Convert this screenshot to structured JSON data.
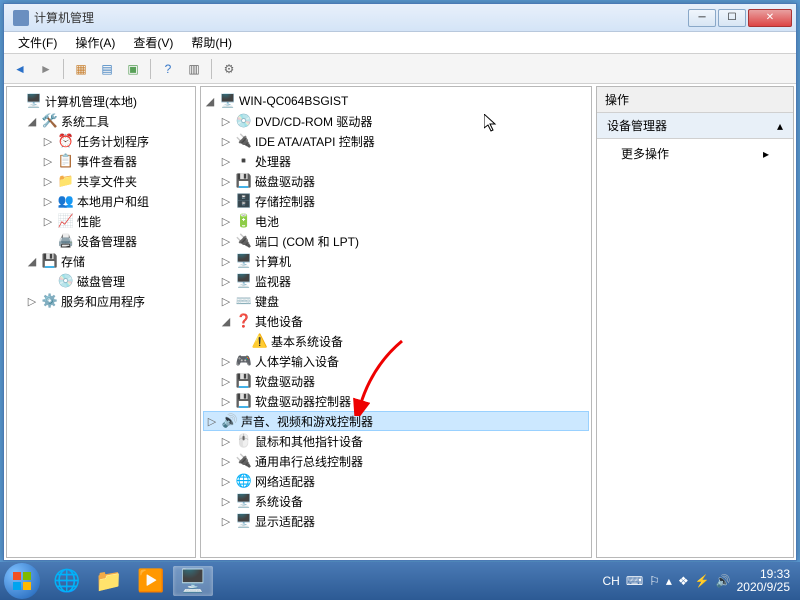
{
  "window": {
    "title": "计算机管理"
  },
  "menu": [
    "文件(F)",
    "操作(A)",
    "查看(V)",
    "帮助(H)"
  ],
  "left": {
    "root": "计算机管理(本地)",
    "n1": {
      "label": "系统工具",
      "children": [
        "任务计划程序",
        "事件查看器",
        "共享文件夹",
        "本地用户和组",
        "性能",
        "设备管理器"
      ]
    },
    "n2": {
      "label": "存储",
      "children": [
        "磁盘管理"
      ]
    },
    "n3": {
      "label": "服务和应用程序"
    }
  },
  "mid": {
    "root": "WIN-QC064BSGIST",
    "items": [
      "DVD/CD-ROM 驱动器",
      "IDE ATA/ATAPI 控制器",
      "处理器",
      "磁盘驱动器",
      "存储控制器",
      "电池",
      "端口 (COM 和 LPT)",
      "计算机",
      "监视器",
      "键盘"
    ],
    "other": {
      "label": "其他设备",
      "child": "基本系统设备"
    },
    "items2": [
      "人体学输入设备",
      "软盘驱动器",
      "软盘驱动器控制器"
    ],
    "selected": "声音、视频和游戏控制器",
    "items3": [
      "鼠标和其他指针设备",
      "通用串行总线控制器",
      "网络适配器",
      "系统设备",
      "显示适配器"
    ]
  },
  "right": {
    "header": "操作",
    "group": "设备管理器",
    "item": "更多操作"
  },
  "taskbar": {
    "ch": "CH",
    "time": "19:33",
    "date": "2020/9/25"
  }
}
